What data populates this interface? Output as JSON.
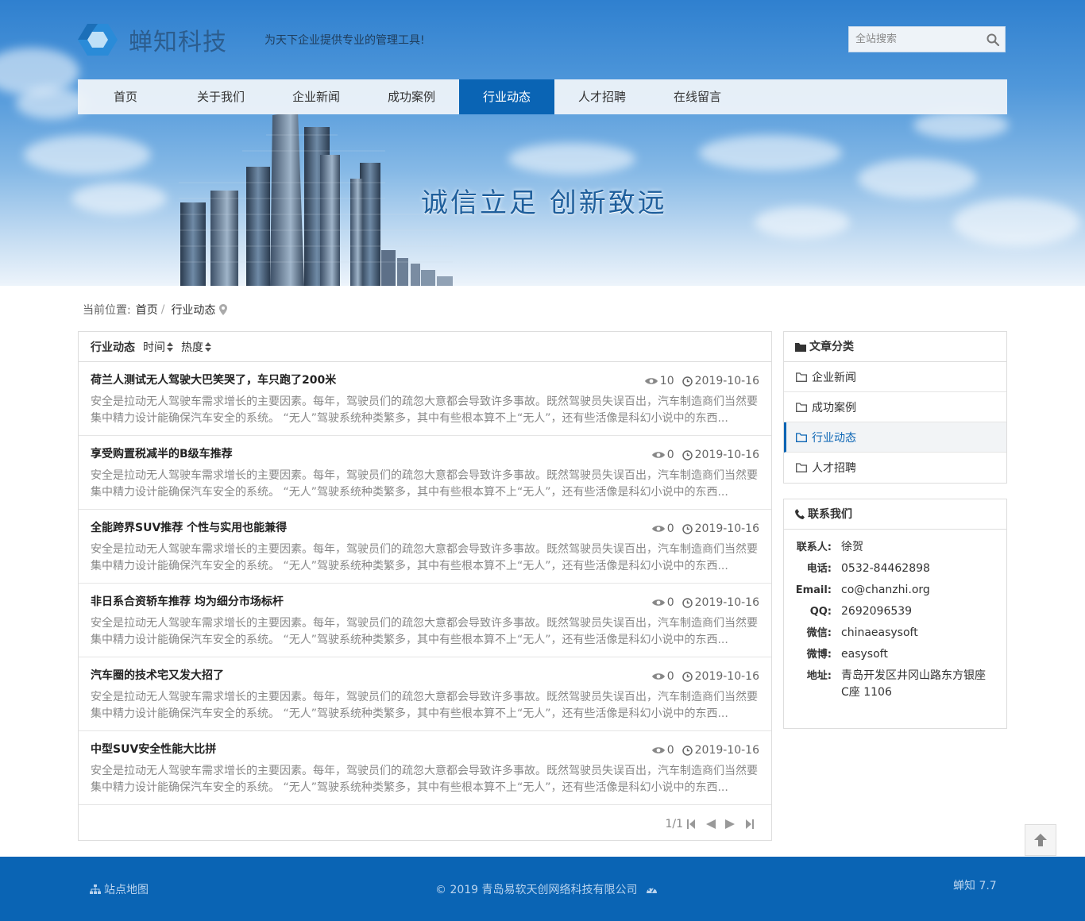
{
  "header": {
    "brand": "蝉知科技",
    "slogan": "为天下企业提供专业的管理工具!",
    "search_placeholder": "全站搜索"
  },
  "nav": [
    {
      "label": "首页"
    },
    {
      "label": "关于我们"
    },
    {
      "label": "企业新闻"
    },
    {
      "label": "成功案例"
    },
    {
      "label": "行业动态",
      "active": true
    },
    {
      "label": "人才招聘"
    },
    {
      "label": "在线留言"
    }
  ],
  "banner": {
    "title": "诚信立足  创新致远"
  },
  "breadcrumb": {
    "prefix": "当前位置:",
    "home": "首页",
    "sep": "/",
    "current": "行业动态"
  },
  "list": {
    "title": "行业动态",
    "sort_time": "时间",
    "sort_hot": "热度",
    "articles": [
      {
        "title": "荷兰人测试无人驾驶大巴笑哭了，车只跑了200米",
        "views": "10",
        "date": "2019-10-16",
        "summary": "安全是拉动无人驾驶车需求增长的主要因素。每年，驾驶员们的疏忽大意都会导致许多事故。既然驾驶员失误百出，汽车制造商们当然要集中精力设计能确保汽车安全的系统。 “无人”驾驶系统种类繁多，其中有些根本算不上“无人”，还有些活像是科幻小说中的东西..."
      },
      {
        "title": "享受购置税减半的B级车推荐",
        "views": "0",
        "date": "2019-10-16",
        "summary": "安全是拉动无人驾驶车需求增长的主要因素。每年，驾驶员们的疏忽大意都会导致许多事故。既然驾驶员失误百出，汽车制造商们当然要集中精力设计能确保汽车安全的系统。 “无人”驾驶系统种类繁多，其中有些根本算不上“无人”，还有些活像是科幻小说中的东西..."
      },
      {
        "title": "全能跨界SUV推荐 个性与实用也能兼得",
        "views": "0",
        "date": "2019-10-16",
        "summary": "安全是拉动无人驾驶车需求增长的主要因素。每年，驾驶员们的疏忽大意都会导致许多事故。既然驾驶员失误百出，汽车制造商们当然要集中精力设计能确保汽车安全的系统。 “无人”驾驶系统种类繁多，其中有些根本算不上“无人”，还有些活像是科幻小说中的东西..."
      },
      {
        "title": "非日系合资轿车推荐 均为细分市场标杆",
        "views": "0",
        "date": "2019-10-16",
        "summary": "安全是拉动无人驾驶车需求增长的主要因素。每年，驾驶员们的疏忽大意都会导致许多事故。既然驾驶员失误百出，汽车制造商们当然要集中精力设计能确保汽车安全的系统。 “无人”驾驶系统种类繁多，其中有些根本算不上“无人”，还有些活像是科幻小说中的东西..."
      },
      {
        "title": "汽车圈的技术宅又发大招了",
        "views": "0",
        "date": "2019-10-16",
        "summary": "安全是拉动无人驾驶车需求增长的主要因素。每年，驾驶员们的疏忽大意都会导致许多事故。既然驾驶员失误百出，汽车制造商们当然要集中精力设计能确保汽车安全的系统。 “无人”驾驶系统种类繁多，其中有些根本算不上“无人”，还有些活像是科幻小说中的东西..."
      },
      {
        "title": "中型SUV安全性能大比拼",
        "views": "0",
        "date": "2019-10-16",
        "summary": "安全是拉动无人驾驶车需求增长的主要因素。每年，驾驶员们的疏忽大意都会导致许多事故。既然驾驶员失误百出，汽车制造商们当然要集中精力设计能确保汽车安全的系统。 “无人”驾驶系统种类繁多，其中有些根本算不上“无人”，还有些活像是科幻小说中的东西..."
      }
    ],
    "pager_text": "1/1"
  },
  "sidebar": {
    "categories_title": "文章分类",
    "categories": [
      {
        "label": "企业新闻"
      },
      {
        "label": "成功案例"
      },
      {
        "label": "行业动态",
        "active": true
      },
      {
        "label": "人才招聘"
      }
    ],
    "contact_title": "联系我们",
    "contact": [
      {
        "label": "联系人:",
        "value": "徐贺"
      },
      {
        "label": "电话:",
        "value": "0532-84462898"
      },
      {
        "label": "Email:",
        "value": "co@chanzhi.org"
      },
      {
        "label": "QQ:",
        "value": "2692096539"
      },
      {
        "label": "微信:",
        "value": "chinaeasysoft"
      },
      {
        "label": "微博:",
        "value": "easysoft"
      },
      {
        "label": "地址:",
        "value": "青岛开发区井冈山路东方银座C座 1106"
      }
    ]
  },
  "footer": {
    "sitemap": "站点地图",
    "copyright": "© 2019 青岛易软天创网络科技有限公司",
    "powered": "蝉知 7.7"
  },
  "colors": {
    "primary": "#0a64b4",
    "banner_top": "#2f80cf",
    "banner_title": "#1f5f9c"
  }
}
